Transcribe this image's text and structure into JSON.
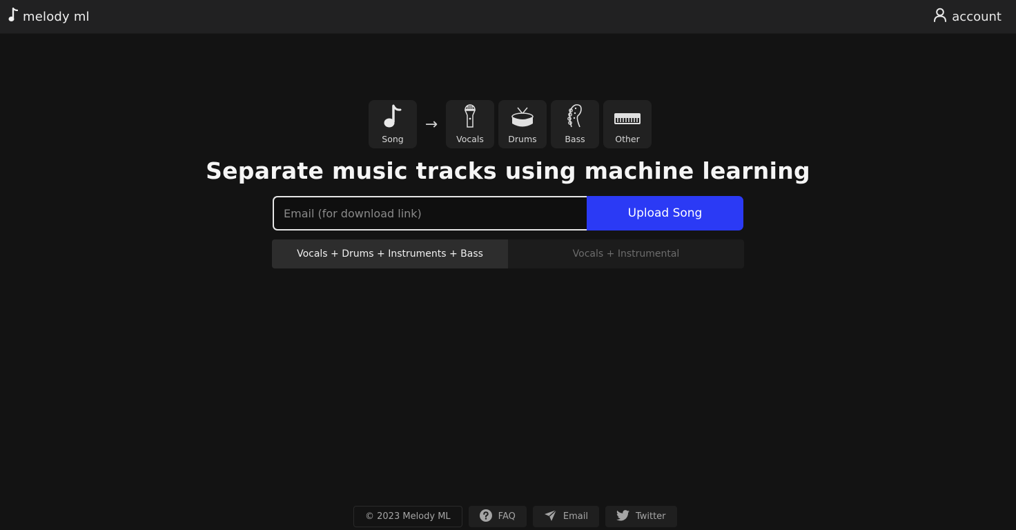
{
  "header": {
    "brand": "melody ml",
    "brand_icon": "music-note-icon",
    "account_label": "account",
    "account_icon": "user-icon"
  },
  "pipeline": {
    "arrow": "→",
    "source": {
      "label": "Song",
      "icon": "music-note-icon"
    },
    "stems": [
      {
        "label": "Vocals",
        "icon": "microphone-icon"
      },
      {
        "label": "Drums",
        "icon": "drum-icon"
      },
      {
        "label": "Bass",
        "icon": "bass-guitar-icon"
      },
      {
        "label": "Other",
        "icon": "keyboard-icon"
      }
    ]
  },
  "headline": "Separate music tracks using machine learning",
  "upload": {
    "email_placeholder": "Email (for download link)",
    "email_value": "",
    "button_label": "Upload Song",
    "accent_color": "#2b3af5"
  },
  "modes": [
    {
      "label": "Vocals + Drums + Instruments + Bass",
      "selected": true
    },
    {
      "label": "Vocals + Instrumental",
      "selected": false
    }
  ],
  "footer": {
    "copyright": "© 2023 Melody ML",
    "links": [
      {
        "label": "FAQ",
        "icon": "question-circle-icon"
      },
      {
        "label": "Email",
        "icon": "paper-plane-icon"
      },
      {
        "label": "Twitter",
        "icon": "twitter-icon"
      }
    ]
  }
}
